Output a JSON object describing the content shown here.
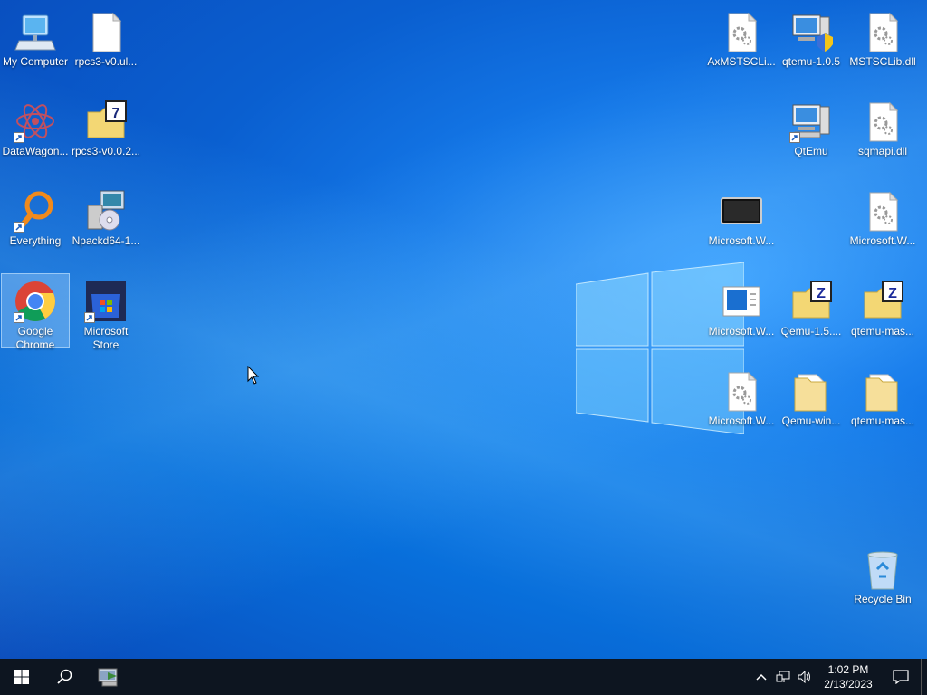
{
  "desktop": {
    "icons": [
      {
        "id": "my-computer",
        "label": "My Computer"
      },
      {
        "id": "rpcs3-ul",
        "label": "rpcs3-v0.ul..."
      },
      {
        "id": "datawagon",
        "label": "DataWagon..."
      },
      {
        "id": "rpcs3-v002",
        "label": "rpcs3-v0.0.2..."
      },
      {
        "id": "everything",
        "label": "Everything"
      },
      {
        "id": "npackd",
        "label": "Npackd64-1..."
      },
      {
        "id": "chrome",
        "label": "Google Chrome"
      },
      {
        "id": "store",
        "label": "Microsoft Store"
      },
      {
        "id": "axmstsc",
        "label": "AxMSTSCLi..."
      },
      {
        "id": "qtemu105",
        "label": "qtemu-1.0.5"
      },
      {
        "id": "mstsclib",
        "label": "MSTSCLib.dll"
      },
      {
        "id": "qtemu",
        "label": "QtEmu"
      },
      {
        "id": "sqmapi",
        "label": "sqmapi.dll"
      },
      {
        "id": "mswin1",
        "label": "Microsoft.W..."
      },
      {
        "id": "mswin2",
        "label": "Microsoft.W..."
      },
      {
        "id": "mswin3",
        "label": "Microsoft.W..."
      },
      {
        "id": "qemu15",
        "label": "Qemu-1.5...."
      },
      {
        "id": "qtemumas1",
        "label": "qtemu-mas..."
      },
      {
        "id": "mswin4",
        "label": "Microsoft.W..."
      },
      {
        "id": "qemuwin",
        "label": "Qemu-win..."
      },
      {
        "id": "qtemumas2",
        "label": "qtemu-mas..."
      },
      {
        "id": "recycle",
        "label": "Recycle Bin"
      }
    ]
  },
  "taskbar": {
    "clock_time": "1:02 PM",
    "clock_date": "2/13/2023"
  }
}
